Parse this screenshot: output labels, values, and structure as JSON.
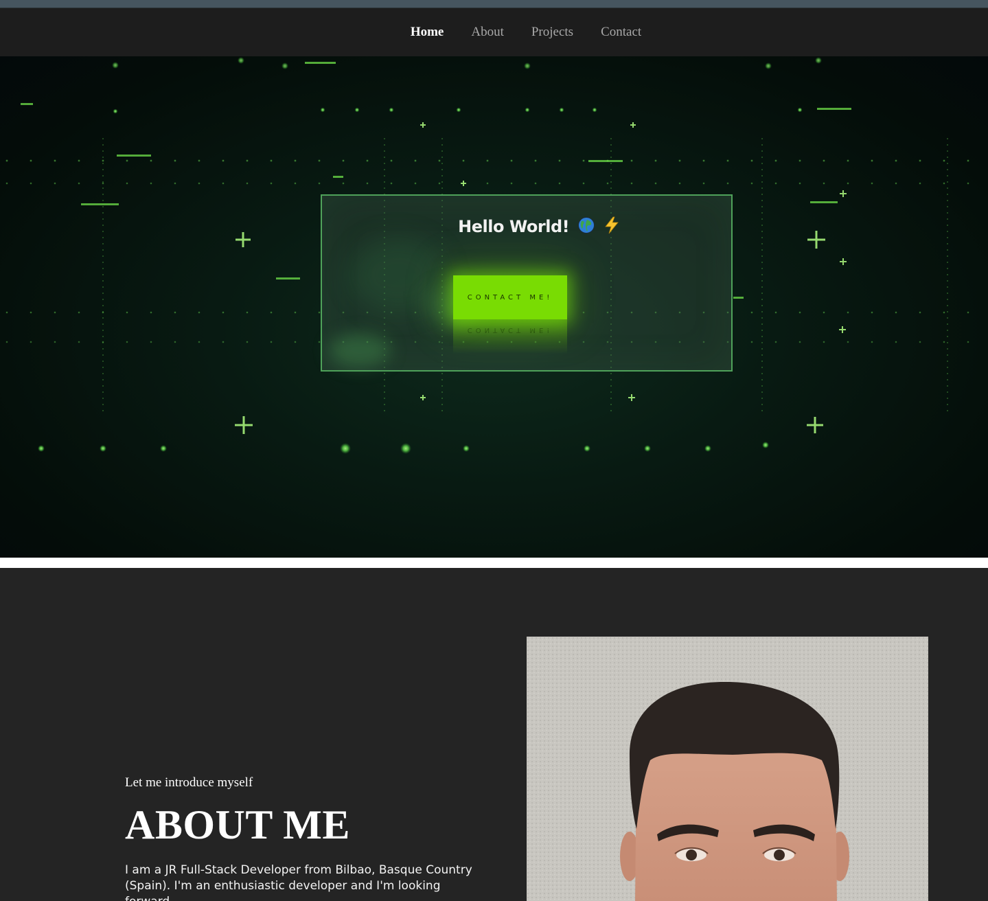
{
  "nav": {
    "items": [
      {
        "label": "Home",
        "active": true
      },
      {
        "label": "About",
        "active": false
      },
      {
        "label": "Projects",
        "active": false
      },
      {
        "label": "Contact",
        "active": false
      }
    ]
  },
  "hero": {
    "greeting": "Hello World!",
    "emoji_icons": [
      "globe-icon",
      "lightning-icon"
    ],
    "cta_label": "CONTACT ME!",
    "accent_color": "#79dc03"
  },
  "about": {
    "kicker": "Let me introduce myself",
    "title": "ABOUT ME",
    "paragraph": "I am a JR Full-Stack Developer from Bilbao, Basque Country (Spain). I'm an enthusiastic developer and I'm looking forward"
  }
}
